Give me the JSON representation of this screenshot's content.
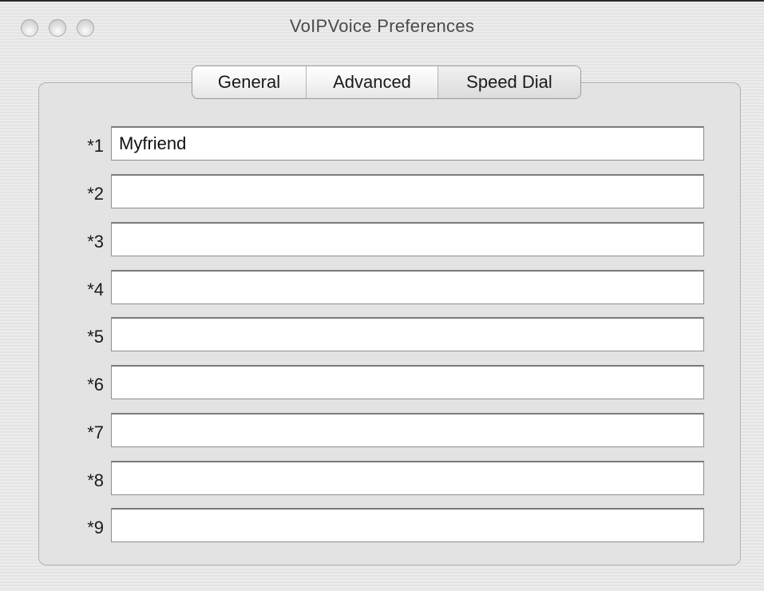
{
  "window": {
    "title": "VoIPVoice Preferences"
  },
  "traffic_lights": {
    "close_icon": "circle-icon",
    "minimize_icon": "circle-icon",
    "zoom_icon": "circle-icon"
  },
  "tabs": [
    {
      "label": "General",
      "selected": false
    },
    {
      "label": "Advanced",
      "selected": false
    },
    {
      "label": "Speed Dial",
      "selected": true
    }
  ],
  "speed_dial": {
    "rows": [
      {
        "label": "*1",
        "value": "Myfriend"
      },
      {
        "label": "*2",
        "value": ""
      },
      {
        "label": "*3",
        "value": ""
      },
      {
        "label": "*4",
        "value": ""
      },
      {
        "label": "*5",
        "value": ""
      },
      {
        "label": "*6",
        "value": ""
      },
      {
        "label": "*7",
        "value": ""
      },
      {
        "label": "*8",
        "value": ""
      },
      {
        "label": "*9",
        "value": ""
      }
    ]
  }
}
